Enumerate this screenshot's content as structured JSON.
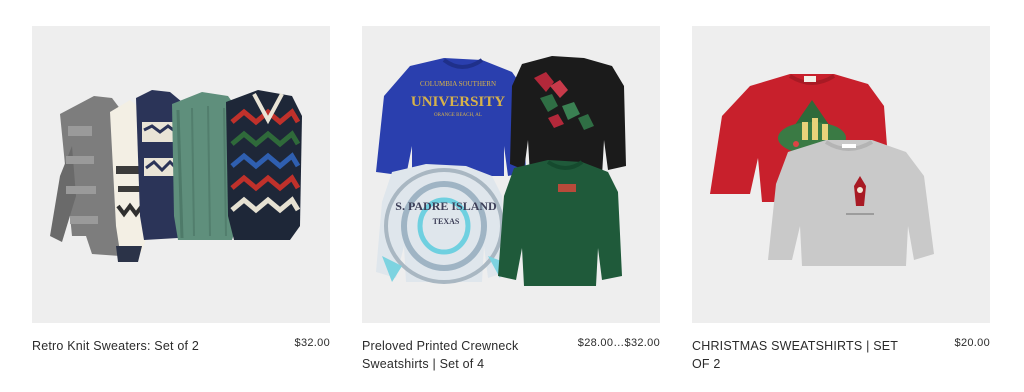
{
  "products": [
    {
      "title": "Retro Knit Sweaters: Set of 2",
      "price": "$32.00",
      "image": "knit-sweaters-photo"
    },
    {
      "title": "Preloved Printed Crewneck Sweatshirts | Set of 4",
      "price": "$28.00…$32.00",
      "image": "crewneck-sweatshirts-photo",
      "print_texts": [
        "COLUMBIA SOUTHERN",
        "UNIVERSITY",
        "ORANGE BEACH, AL",
        "S. PADRE ISLAND",
        "TEXAS"
      ]
    },
    {
      "title": "CHRISTMAS SWEATSHIRTS | SET OF 2",
      "price": "$20.00",
      "image": "christmas-sweatshirts-photo"
    }
  ],
  "colors": {
    "image_bg": "#eeeeee",
    "text": "#2b2b2b",
    "blue_sweatshirt": "#2a3fae",
    "green_sweatshirt": "#1f5a3a",
    "red_sweatshirt": "#c8202c",
    "grey_sweatshirt": "#c9c9c9"
  }
}
